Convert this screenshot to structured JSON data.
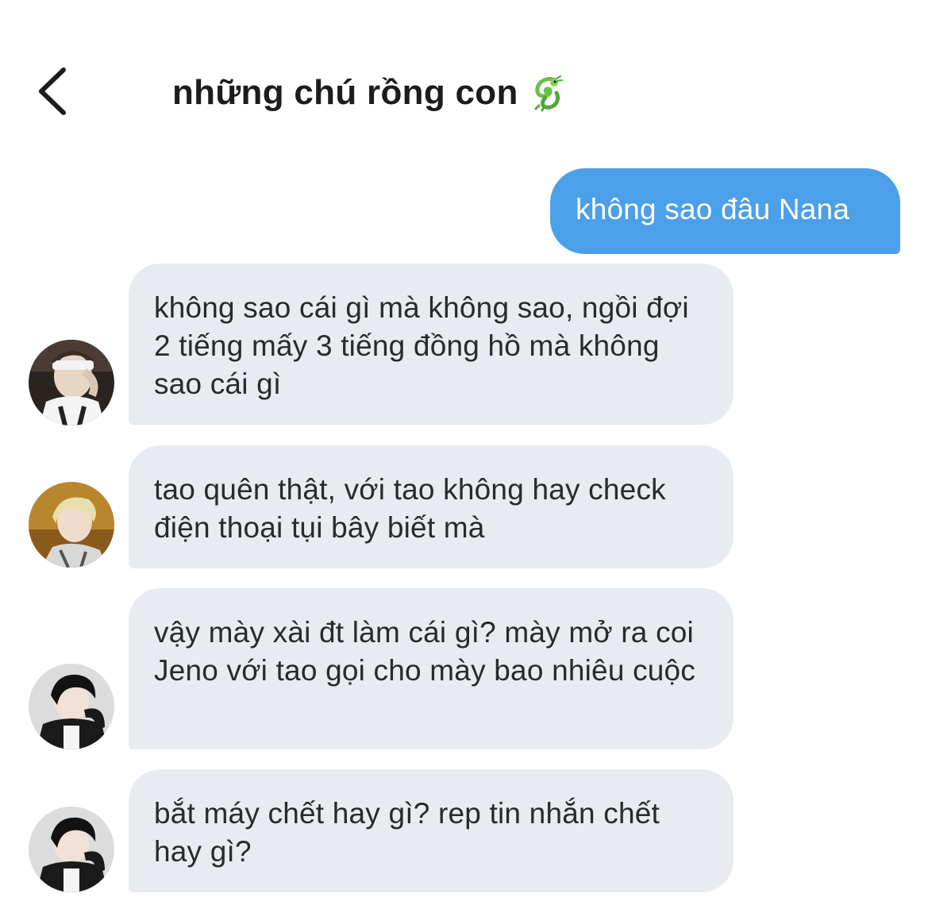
{
  "header": {
    "back_icon": "chevron-left-icon",
    "title": "những chú rồng con",
    "title_emoji": "dragon-icon"
  },
  "messages": [
    {
      "direction": "outgoing",
      "text": "không sao đâu Nana"
    },
    {
      "direction": "incoming",
      "text": "không sao cái gì mà không sao, ngồi đợi 2 tiếng mấy 3 tiếng đồng hồ mà không sao cái gì"
    },
    {
      "direction": "incoming",
      "text": "tao quên thật, với tao không hay check điện thoại tụi bây biết mà"
    },
    {
      "direction": "incoming",
      "text": "vậy mày xài đt làm cái gì? mày mở ra coi Jeno với tao gọi cho mày bao nhiêu cuộc"
    },
    {
      "direction": "incoming",
      "text": "bắt máy chết hay gì? rep tin nhắn chết hay gì?"
    }
  ],
  "colors": {
    "outgoing_bubble": "#4c9fe9",
    "incoming_bubble": "#e8ebef"
  }
}
